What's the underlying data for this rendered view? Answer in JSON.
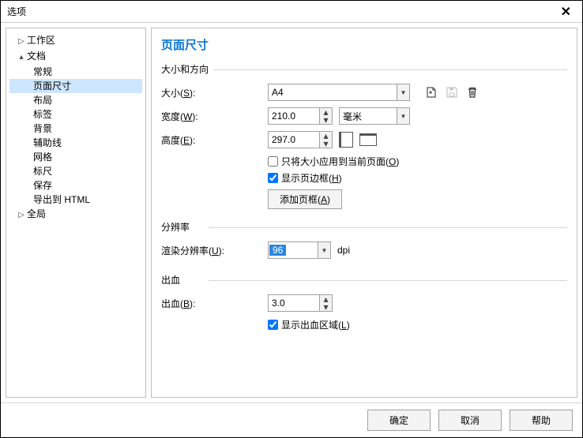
{
  "title": "选项",
  "tree": {
    "workspace": "工作区",
    "document": "文档",
    "children": {
      "general": "常规",
      "pagesize": "页面尺寸",
      "layout": "布局",
      "labels": "标签",
      "background": "背景",
      "guides": "辅助线",
      "grid": "网格",
      "ruler": "标尺",
      "save": "保存",
      "export_html": "导出到 HTML"
    },
    "global": "全局"
  },
  "page": {
    "title": "页面尺寸",
    "section_size": "大小和方向",
    "size_label": "大小(S):",
    "size_value": "A4",
    "width_label": "宽度(W):",
    "width_value": "210.0",
    "unit_value": "毫米",
    "height_label": "高度(E):",
    "height_value": "297.0",
    "apply_current_label": "只将大小应用到当前页面(O)",
    "show_border_label": "显示页边框(H)",
    "add_border_btn": "添加页框(A)",
    "section_res": "分辨率",
    "res_label": "渲染分辨率(U):",
    "res_value": "96",
    "res_unit": "dpi",
    "section_bleed": "出血",
    "bleed_label": "出血(B):",
    "bleed_value": "3.0",
    "show_bleed_label": "显示出血区域(L)"
  },
  "footer": {
    "ok": "确定",
    "cancel": "取消",
    "help": "帮助"
  }
}
